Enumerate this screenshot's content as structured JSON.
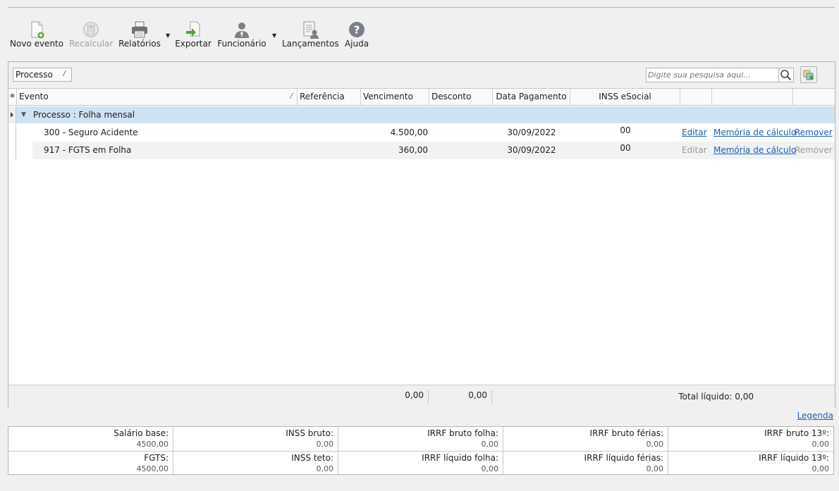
{
  "toolbar": {
    "novo_evento": "Novo evento",
    "recalcular": "Recalcular",
    "relatorios": "Relatórios",
    "exportar": "Exportar",
    "funcionario": "Funcionário",
    "lancamentos": "Lançamentos",
    "ajuda": "Ajuda"
  },
  "filter": {
    "group_label": "Processo",
    "search_placeholder": "Digite sua pesquisa aqui..."
  },
  "grid": {
    "columns": {
      "evento": "Evento",
      "referencia": "Referência",
      "vencimento": "Vencimento",
      "desconto": "Desconto",
      "data_pagamento": "Data Pagamento",
      "inss_esocial": "INSS eSocial"
    },
    "group_title": "Processo : Folha mensal",
    "rows": [
      {
        "evento": "300 - Seguro Acidente",
        "vencimento": "4.500,00",
        "data_pagamento": "30/09/2022",
        "inss": "00",
        "editar": "Editar",
        "memoria": "Memória de cálculo",
        "remover": "Remover"
      },
      {
        "evento": "917 - FGTS em Folha",
        "vencimento": "360,00",
        "data_pagamento": "30/09/2022",
        "inss": "00",
        "editar": "Editar",
        "memoria": "Memória de cálculo",
        "remover": "Remover"
      }
    ],
    "footer": {
      "total_vencimento": "0,00",
      "total_desconto": "0,00",
      "total_liquido": "Total líquido: 0,00"
    }
  },
  "legenda": "Legenda",
  "summary": {
    "salario_base": {
      "label": "Salário base:",
      "value": "4500,00"
    },
    "inss_bruto": {
      "label": "INSS bruto:",
      "value": "0,00"
    },
    "irrf_bruto_folha": {
      "label": "IRRF bruto folha:",
      "value": "0,00"
    },
    "irrf_bruto_ferias": {
      "label": "IRRF bruto férias:",
      "value": "0,00"
    },
    "irrf_bruto_13": {
      "label": "IRRF bruto 13º:",
      "value": "0,00"
    },
    "fgts": {
      "label": "FGTS:",
      "value": "4500,00"
    },
    "inss_teto": {
      "label": "INSS teto:",
      "value": "0,00"
    },
    "irrf_liquido_folha": {
      "label": "IRRF líquido folha:",
      "value": "0,00"
    },
    "irrf_liquido_ferias": {
      "label": "IRRF líquido férias:",
      "value": "0,00"
    },
    "irrf_liquido_13": {
      "label": "IRRF líquido 13º:",
      "value": "0,00"
    }
  },
  "colors": {
    "link": "#1a5fb4",
    "group_row": "#cfe2f2",
    "background": "#f0f0f0"
  }
}
